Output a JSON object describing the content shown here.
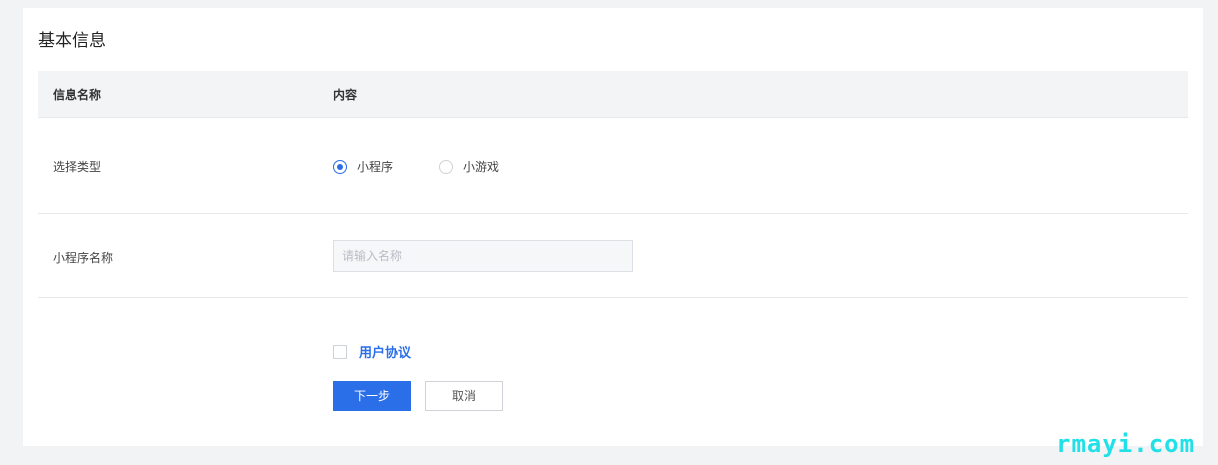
{
  "section": {
    "title": "基本信息"
  },
  "table": {
    "headers": {
      "name": "信息名称",
      "content": "内容"
    },
    "rows": {
      "type": {
        "label": "选择类型",
        "options": [
          {
            "label": "小程序",
            "checked": true
          },
          {
            "label": "小游戏",
            "checked": false
          }
        ]
      },
      "name": {
        "label": "小程序名称",
        "placeholder": "请输入名称",
        "value": ""
      }
    }
  },
  "agreement": {
    "label": "用户协议",
    "checked": false
  },
  "actions": {
    "next_label": "下一步",
    "cancel_label": "取消"
  },
  "watermark": {
    "text": "rmayi.com"
  },
  "colors": {
    "primary": "#2a6ee8",
    "header_bg": "#f3f4f6",
    "page_bg": "#f2f3f5"
  }
}
